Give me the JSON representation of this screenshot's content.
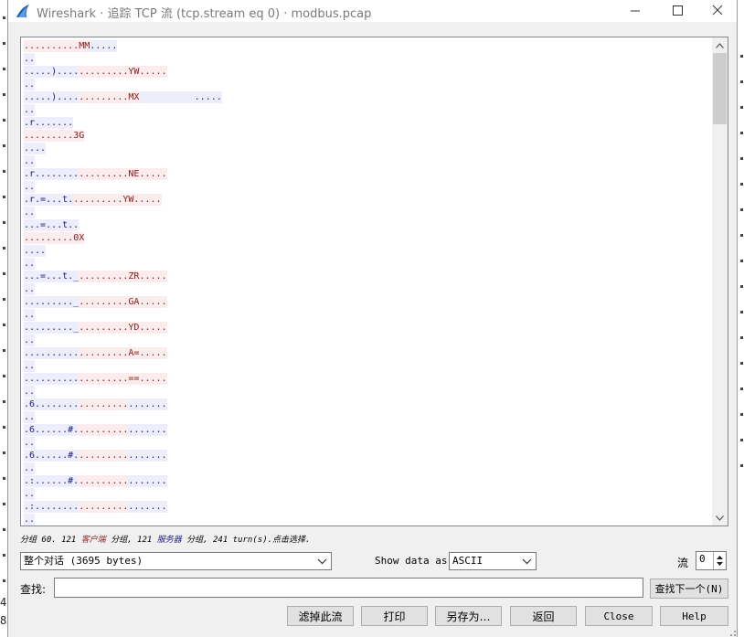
{
  "background_window": {
    "edge_digits": [
      "4",
      "8"
    ]
  },
  "window": {
    "title": "Wireshark · 追踪 TCP 流 (tcp.stream eq 0) · modbus.pcap"
  },
  "colors": {
    "client_text": "#8a1a1a",
    "client_bg": "#fbeded",
    "server_text": "#1a1a82",
    "server_bg": "#ededfb"
  },
  "stream": {
    "lines": [
      [
        [
          "c",
          ".........."
        ],
        [
          "c",
          "MM"
        ],
        [
          "s",
          "....."
        ]
      ],
      [
        [
          "s",
          ".."
        ]
      ],
      [
        [
          "s",
          "....."
        ],
        [
          "s",
          ")...."
        ],
        [
          "c",
          "........."
        ],
        [
          "c",
          "YW....."
        ]
      ],
      [
        [
          "s",
          ".."
        ]
      ],
      [
        [
          "s",
          "....."
        ],
        [
          "s",
          ")...."
        ],
        [
          "c",
          "........."
        ],
        [
          "c",
          "MX"
        ],
        [
          "s",
          "          ....."
        ]
      ],
      [
        [
          "s",
          ".."
        ]
      ],
      [
        [
          "s",
          ".r......."
        ]
      ],
      [
        [
          "c",
          "........."
        ],
        [
          "c",
          "3G"
        ]
      ],
      [
        [
          "s",
          "...."
        ]
      ],
      [
        [
          "s",
          ".."
        ]
      ],
      [
        [
          "s",
          ".r........"
        ],
        [
          "c",
          "........."
        ],
        [
          "c",
          "NE....."
        ]
      ],
      [
        [
          "s",
          ".."
        ]
      ],
      [
        [
          "s",
          ".r.=...t."
        ],
        [
          "c",
          "........."
        ],
        [
          "c",
          "YW....."
        ]
      ],
      [
        [
          "s",
          ".."
        ]
      ],
      [
        [
          "s",
          "...=...t.."
        ]
      ],
      [
        [
          "c",
          "........."
        ],
        [
          "c",
          "0X"
        ]
      ],
      [
        [
          "s",
          "...."
        ]
      ],
      [
        [
          "s",
          ".."
        ]
      ],
      [
        [
          "s",
          "...=...t._"
        ],
        [
          "c",
          "........."
        ],
        [
          "c",
          "ZR....."
        ]
      ],
      [
        [
          "s",
          ".."
        ]
      ],
      [
        [
          "s",
          "........._"
        ],
        [
          "c",
          "........."
        ],
        [
          "c",
          "GA....."
        ]
      ],
      [
        [
          "s",
          ".."
        ]
      ],
      [
        [
          "s",
          "........._"
        ],
        [
          "c",
          "........."
        ],
        [
          "c",
          "YD....."
        ]
      ],
      [
        [
          "s",
          ".."
        ]
      ],
      [
        [
          "s",
          ".........."
        ],
        [
          "c",
          "........."
        ],
        [
          "c",
          "A=....."
        ]
      ],
      [
        [
          "s",
          ".."
        ]
      ],
      [
        [
          "s",
          ".........."
        ],
        [
          "c",
          "........."
        ],
        [
          "c",
          "==....."
        ]
      ],
      [
        [
          "s",
          ".."
        ]
      ],
      [
        [
          "s",
          ".6........"
        ],
        [
          "c",
          "........."
        ],
        [
          "s",
          "......."
        ]
      ],
      [
        [
          "s",
          ".."
        ]
      ],
      [
        [
          "s",
          ".6......#."
        ],
        [
          "c",
          "........."
        ],
        [
          "s",
          "......."
        ]
      ],
      [
        [
          "s",
          ".."
        ]
      ],
      [
        [
          "s",
          ".6......#."
        ],
        [
          "c",
          "........."
        ],
        [
          "s",
          "......."
        ]
      ],
      [
        [
          "s",
          ".."
        ]
      ],
      [
        [
          "s",
          ".:......#."
        ],
        [
          "c",
          "........."
        ],
        [
          "s",
          "......."
        ]
      ],
      [
        [
          "s",
          ".."
        ]
      ],
      [
        [
          "s",
          ".:........"
        ],
        [
          "c",
          "........."
        ],
        [
          "s",
          "......."
        ]
      ],
      [
        [
          "s",
          ".."
        ]
      ]
    ]
  },
  "status": {
    "pre": "分组 60. 121 ",
    "client": "客户端",
    "mid": " 分组, 121 ",
    "server": "服务器",
    "post": " 分组, 241 turn(s).点击选择."
  },
  "controls": {
    "conversation": "整个对话 (3695 bytes)",
    "show_data_as_label": "Show data as",
    "show_data_as_value": "ASCII",
    "stream_label": "流",
    "stream_value": "0",
    "find_label": "查找:",
    "find_value": "",
    "find_next": "查找下一个(N)"
  },
  "buttons": {
    "filter_out": "滤掉此流",
    "print": "打印",
    "save_as": "另存为…",
    "back": "返回",
    "close": "Close",
    "help": "Help"
  }
}
